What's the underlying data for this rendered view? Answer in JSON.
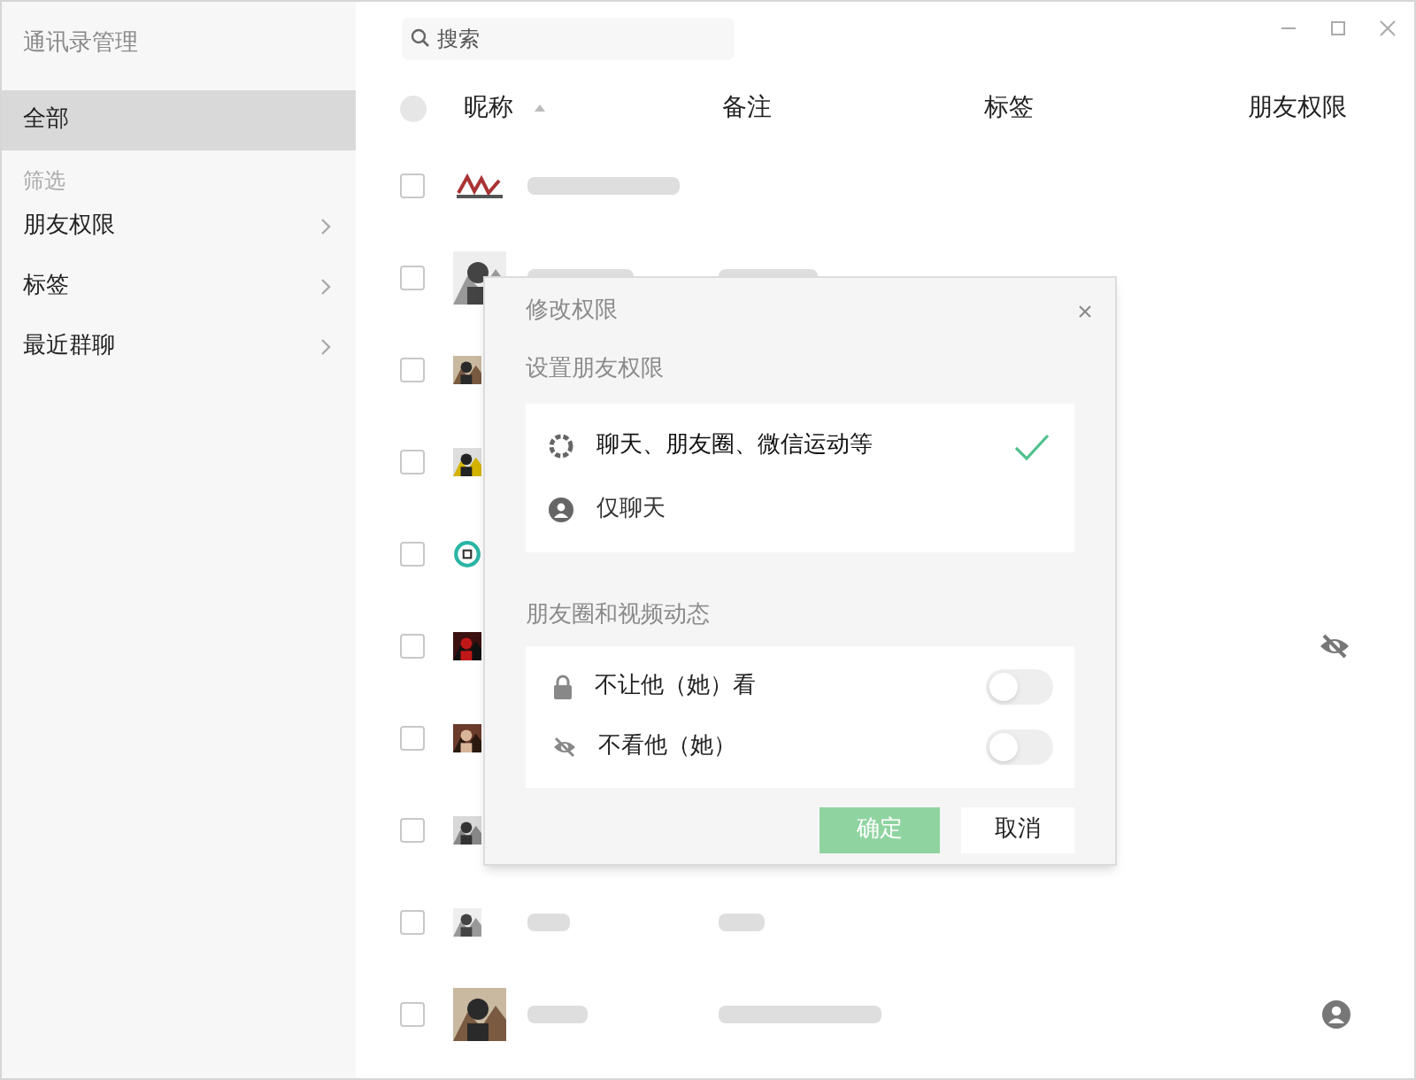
{
  "sidebar": {
    "title": "通讯录管理",
    "items": [
      {
        "label": "全部",
        "selected": true
      }
    ],
    "filter_heading": "筛选",
    "filters": [
      {
        "label": "朋友权限"
      },
      {
        "label": "标签"
      },
      {
        "label": "最近群聊"
      }
    ]
  },
  "search": {
    "placeholder": "搜索"
  },
  "table": {
    "all_checked": false,
    "columns": [
      "昵称",
      "备注",
      "标签",
      "朋友权限"
    ],
    "rows": [
      {
        "checked": false
      },
      {
        "checked": false
      },
      {
        "checked": false
      },
      {
        "checked": false
      },
      {
        "checked": false
      },
      {
        "checked": false,
        "kind": "hide_moments"
      },
      {
        "checked": false
      },
      {
        "checked": false
      },
      {
        "checked": false
      },
      {
        "checked": false,
        "kind": "chat_only"
      }
    ]
  },
  "dialog": {
    "title": "修改权限",
    "section_1": "设置朋友权限",
    "options": [
      {
        "label": "聊天、朋友圈、微信运动等",
        "kind": "all",
        "selected": true
      },
      {
        "label": "仅聊天",
        "kind": "chat",
        "selected": false
      }
    ],
    "section_2": "朋友圈和视频动态",
    "toggles": [
      {
        "label": "不让他（她）看",
        "kind": "lock",
        "on": false
      },
      {
        "label": "不看他（她）",
        "kind": "eye",
        "on": false
      }
    ],
    "confirm": {
      "label": "确定",
      "disabled": true
    },
    "cancel": "取消"
  }
}
